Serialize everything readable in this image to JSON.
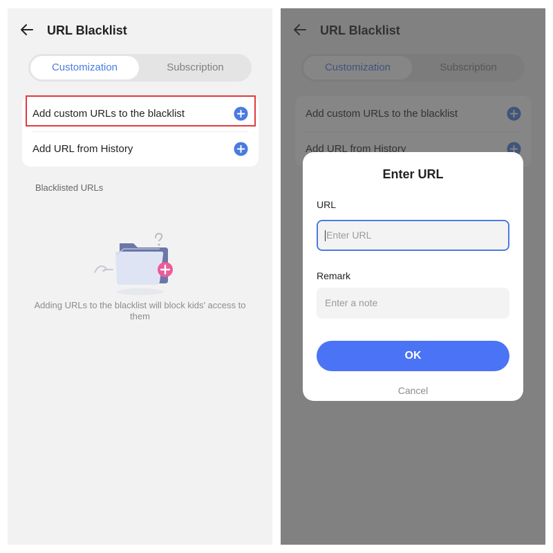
{
  "header": {
    "title": "URL Blacklist",
    "back_icon": "arrow-left-icon"
  },
  "tabs": [
    {
      "label": "Customization",
      "active": true
    },
    {
      "label": "Subscription",
      "active": false
    }
  ],
  "actions": [
    {
      "label": "Add custom URLs to the blacklist",
      "icon": "plus-circle-icon",
      "highlighted": true
    },
    {
      "label": "Add URL from History",
      "icon": "plus-circle-icon",
      "highlighted": false
    }
  ],
  "blacklist": {
    "section_label": "Blacklisted URLs",
    "empty_icon": "empty-folder-icon",
    "empty_message": "Adding URLs to the blacklist will block kids' access to them"
  },
  "dialog": {
    "title": "Enter URL",
    "url_label": "URL",
    "url_placeholder": "Enter URL",
    "url_value": "",
    "remark_label": "Remark",
    "remark_placeholder": "Enter a note",
    "remark_value": "",
    "ok_label": "OK",
    "cancel_label": "Cancel"
  },
  "colors": {
    "accent": "#4a7be0",
    "primary_button": "#4b73f5",
    "highlight_border": "#e0393b",
    "overlay": "#3c3c3c"
  }
}
